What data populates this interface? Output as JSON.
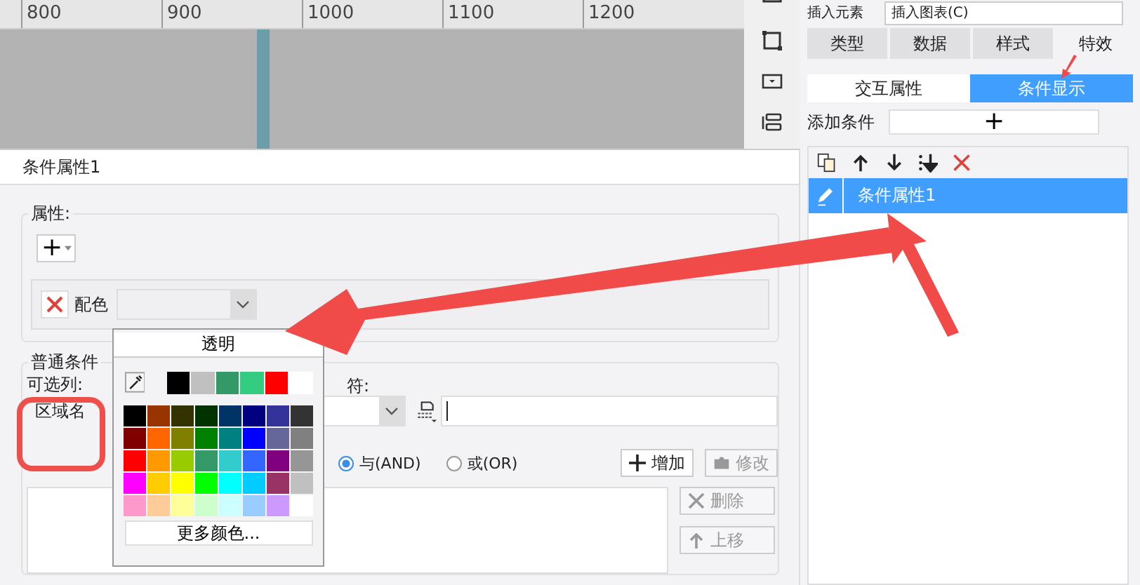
{
  "ruler": {
    "ticks": [
      "800",
      "900",
      "1000",
      "1100",
      "1200"
    ]
  },
  "right_panel": {
    "insert_label": "插入元素",
    "insert_value": "插入图表(C)",
    "tabs": [
      {
        "label": "类型",
        "selected": false
      },
      {
        "label": "数据",
        "selected": false
      },
      {
        "label": "样式",
        "selected": false
      },
      {
        "label": "特效",
        "selected": true
      }
    ],
    "subtabs": [
      {
        "label": "交互属性",
        "selected": false
      },
      {
        "label": "条件显示",
        "selected": true
      }
    ],
    "add_label": "添加条件",
    "add_button": "+",
    "conditions": [
      {
        "label": "条件属性1",
        "selected": true
      }
    ]
  },
  "dialog": {
    "title": "条件属性1",
    "attributes": {
      "legend": "属性:",
      "add_button": "+",
      "rows": [
        {
          "label": "配色"
        }
      ]
    },
    "conditions": {
      "legend": "普通条件",
      "column_label": "可选列:",
      "column_value": "区域名",
      "operator_label": "符:",
      "logic": [
        {
          "label": "与(AND)",
          "selected": true
        },
        {
          "label": "或(OR)",
          "selected": false
        }
      ],
      "buttons": [
        {
          "label": "增加",
          "disabled": false
        },
        {
          "label": "修改",
          "disabled": true
        }
      ],
      "side_buttons": [
        {
          "label": "删除",
          "disabled": true
        },
        {
          "label": "上移",
          "disabled": true
        }
      ]
    }
  },
  "color_popup": {
    "transparent": "透明",
    "more": "更多颜色...",
    "recent": [
      {
        "color": "#000000"
      },
      {
        "color": "#c0c0c0"
      },
      {
        "color": "#339966"
      },
      {
        "color": "#33cc80"
      },
      {
        "color": "#ff0000"
      },
      {
        "color": "#ffffff"
      }
    ],
    "grid": [
      [
        {
          "color": "#000000"
        },
        {
          "color": "#993300"
        },
        {
          "color": "#333300"
        },
        {
          "color": "#003300"
        },
        {
          "color": "#003366"
        },
        {
          "color": "#000080"
        },
        {
          "color": "#333399"
        },
        {
          "color": "#333333"
        }
      ],
      [
        {
          "color": "#800000"
        },
        {
          "color": "#ff6600"
        },
        {
          "color": "#808000"
        },
        {
          "color": "#008000"
        },
        {
          "color": "#008080"
        },
        {
          "color": "#0000ff"
        },
        {
          "color": "#666699"
        },
        {
          "color": "#808080"
        }
      ],
      [
        {
          "color": "#ff0000"
        },
        {
          "color": "#ff9900"
        },
        {
          "color": "#99cc00"
        },
        {
          "color": "#339966"
        },
        {
          "color": "#33cccc"
        },
        {
          "color": "#3366ff"
        },
        {
          "color": "#800080"
        },
        {
          "color": "#969696"
        }
      ],
      [
        {
          "color": "#ff00ff"
        },
        {
          "color": "#ffcc00"
        },
        {
          "color": "#ffff00"
        },
        {
          "color": "#00ff00"
        },
        {
          "color": "#00ffff"
        },
        {
          "color": "#00ccff"
        },
        {
          "color": "#993366"
        },
        {
          "color": "#c0c0c0"
        }
      ],
      [
        {
          "color": "#ff99cc"
        },
        {
          "color": "#ffcc99"
        },
        {
          "color": "#ffff99"
        },
        {
          "color": "#ccffcc"
        },
        {
          "color": "#ccffff"
        },
        {
          "color": "#99ccff"
        },
        {
          "color": "#cc99ff"
        },
        {
          "color": "#ffffff"
        }
      ]
    ]
  }
}
